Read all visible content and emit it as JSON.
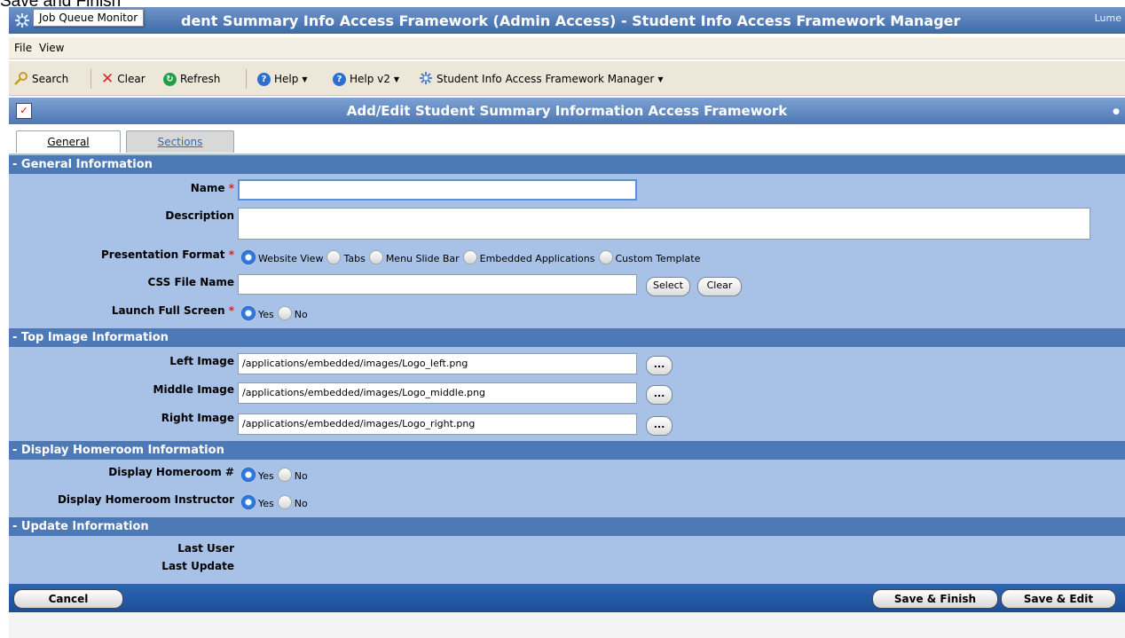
{
  "top_caption": "Save and Finish",
  "titlebar": {
    "tooltip": "Job Queue Monitor",
    "title": "dent Summary Info Access Framework (Admin Access) - Student Info Access Framework Manager",
    "brand": "Lume"
  },
  "menu": {
    "file": "File",
    "view": "View"
  },
  "toolbar": {
    "search": "Search",
    "clear": "Clear",
    "refresh": "Refresh",
    "help": "Help",
    "help_v2": "Help v2",
    "manager": "Student Info Access Framework Manager"
  },
  "form": {
    "title": "Add/Edit Student Summary Information Access Framework",
    "tabs": [
      {
        "label": "General"
      },
      {
        "label": "Sections"
      }
    ]
  },
  "sections": {
    "general": "- General Information",
    "top_image": "- Top Image Information",
    "homeroom": "- Display Homeroom Information",
    "update": "- Update Information"
  },
  "fields": {
    "name_label": "Name",
    "name_value": "",
    "description_label": "Description",
    "description_value": "",
    "presentation_label": "Presentation Format",
    "presentation_options": [
      "Website View",
      "Tabs",
      "Menu Slide Bar",
      "Embedded Applications",
      "Custom Template"
    ],
    "presentation_selected": "Website View",
    "css_label": "CSS File Name",
    "css_value": "",
    "select_btn": "Select",
    "clear_btn": "Clear",
    "launch_label": "Launch Full Screen",
    "yes": "Yes",
    "no": "No",
    "left_image_label": "Left Image",
    "left_image_value": "/applications/embedded/images/Logo_left.png",
    "middle_image_label": "Middle Image",
    "middle_image_value": "/applications/embedded/images/Logo_middle.png",
    "right_image_label": "Right Image",
    "right_image_value": "/applications/embedded/images/Logo_right.png",
    "browse_btn": "...",
    "homeroom_num_label": "Display Homeroom #",
    "homeroom_instr_label": "Display Homeroom Instructor",
    "last_user_label": "Last User",
    "last_update_label": "Last Update"
  },
  "buttons": {
    "cancel": "Cancel",
    "save_finish": "Save & Finish",
    "save_edit": "Save & Edit"
  }
}
